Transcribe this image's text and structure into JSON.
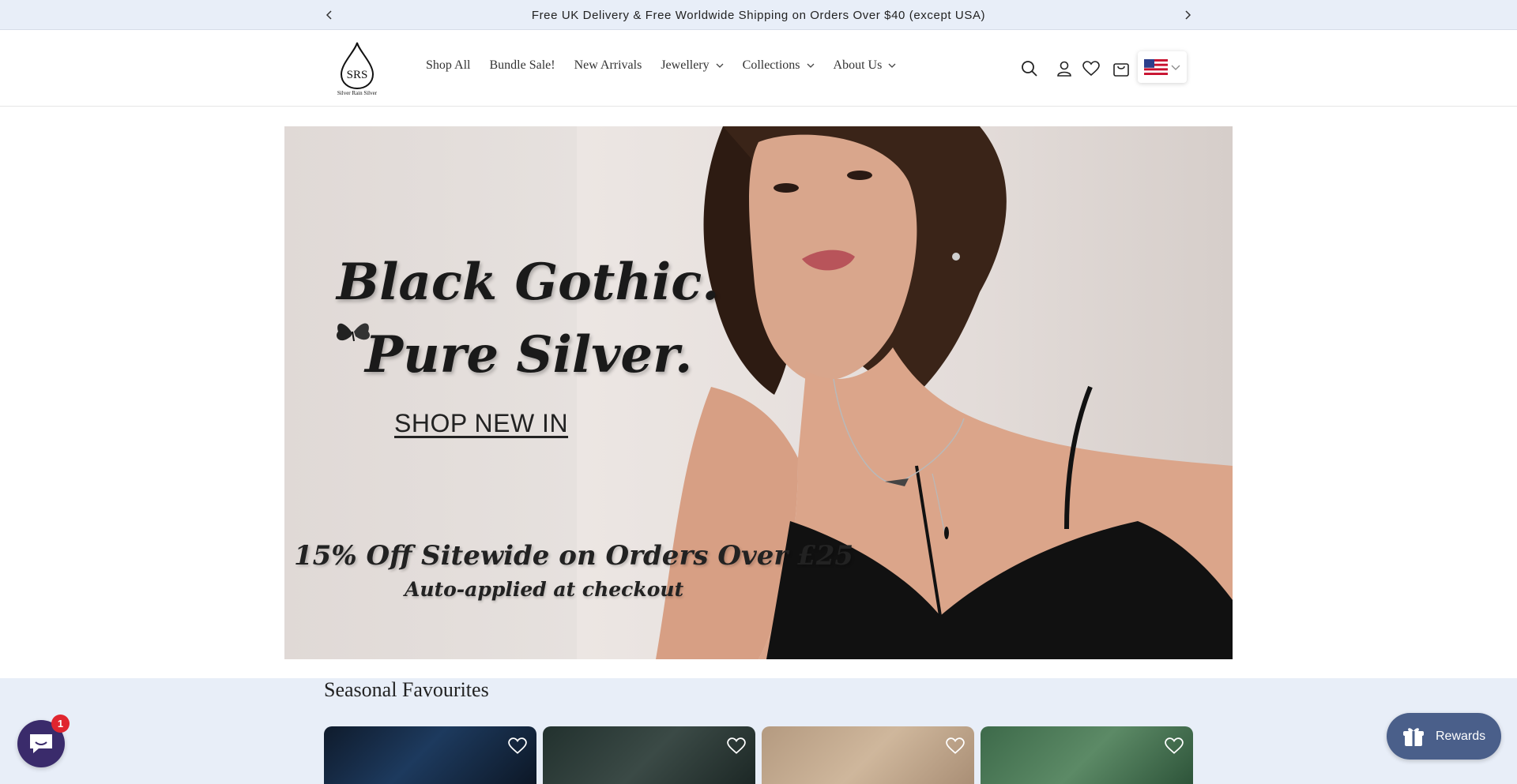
{
  "announcement": {
    "text": "Free UK Delivery & Free Worldwide Shipping on Orders Over $40 (except USA)"
  },
  "header": {
    "logo_monogram": "SRS",
    "logo_text": "Silver Rain Silver",
    "nav": [
      {
        "label": "Shop All",
        "has_dropdown": false
      },
      {
        "label": "Bundle Sale!",
        "has_dropdown": false
      },
      {
        "label": "New Arrivals",
        "has_dropdown": false
      },
      {
        "label": "Jewellery",
        "has_dropdown": true
      },
      {
        "label": "Collections",
        "has_dropdown": true
      },
      {
        "label": "About Us",
        "has_dropdown": true
      }
    ],
    "icons": [
      "search-icon",
      "account-icon",
      "wishlist-icon",
      "cart-icon"
    ],
    "country_flag": "us-flag-icon"
  },
  "hero": {
    "line1": "Black Gothic.",
    "line2": "Pure Silver.",
    "cta": "SHOP NEW IN",
    "promo": "15% Off Sitewide on Orders Over £25",
    "promo_sub": "Auto-applied at checkout"
  },
  "seasonal": {
    "title": "Seasonal Favourites",
    "cards": [
      {
        "theme": "dark-blue"
      },
      {
        "theme": "dark-green-leaves"
      },
      {
        "theme": "sand"
      },
      {
        "theme": "green-leaves"
      }
    ]
  },
  "chat": {
    "badge_count": "1"
  },
  "rewards": {
    "label": "Rewards"
  },
  "colors": {
    "announcement_bg": "#e8eef8",
    "section_bg": "#e8eef8",
    "chat_bg": "#3a2b6b",
    "rewards_bg": "#4a5f8a",
    "badge": "#e0252f"
  }
}
